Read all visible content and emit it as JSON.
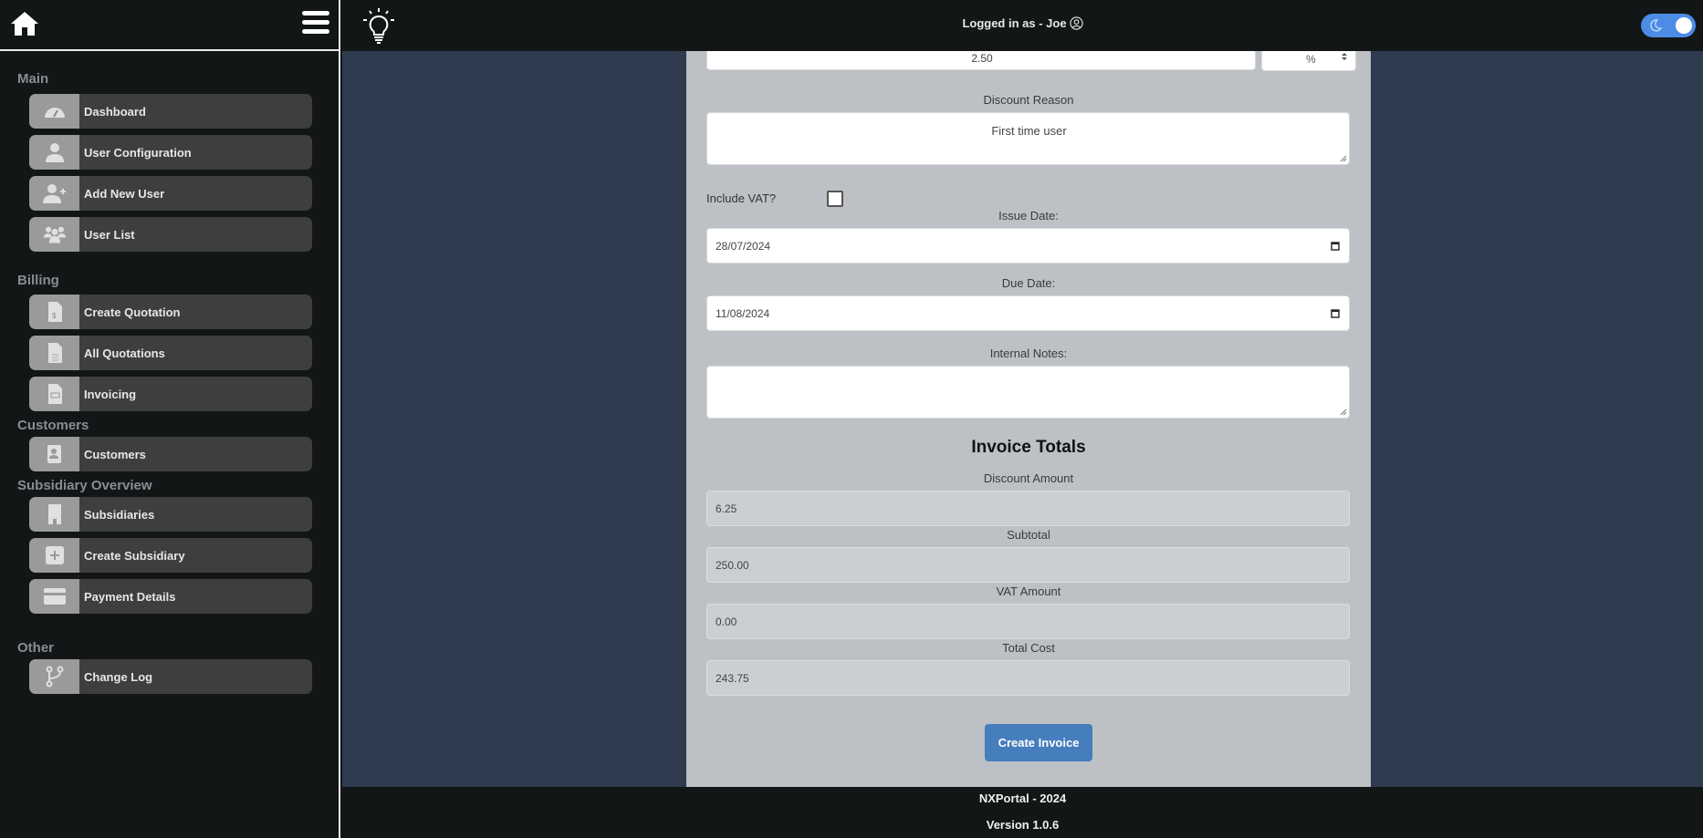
{
  "sidebar": {
    "sections": [
      {
        "title": "Main",
        "items": [
          {
            "label": "Dashboard",
            "icon": "gauge-icon"
          },
          {
            "label": "User Configuration",
            "icon": "user-icon"
          },
          {
            "label": "Add New User",
            "icon": "user-plus-icon"
          },
          {
            "label": "User List",
            "icon": "users-icon"
          }
        ]
      },
      {
        "title": "Billing",
        "items": [
          {
            "label": "Create Quotation",
            "icon": "invoice-dollar-icon"
          },
          {
            "label": "All Quotations",
            "icon": "file-lines-icon"
          },
          {
            "label": "Invoicing",
            "icon": "file-invoice-icon"
          }
        ]
      },
      {
        "title": "Customers",
        "items": [
          {
            "label": "Customers",
            "icon": "address-book-icon"
          }
        ]
      },
      {
        "title": "Subsidiary Overview",
        "items": [
          {
            "label": "Subsidiaries",
            "icon": "building-icon"
          },
          {
            "label": "Create Subsidiary",
            "icon": "plus-square-icon"
          },
          {
            "label": "Payment Details",
            "icon": "credit-card-icon"
          }
        ]
      },
      {
        "title": "Other",
        "items": [
          {
            "label": "Change Log",
            "icon": "code-branch-icon"
          }
        ]
      }
    ]
  },
  "topbar": {
    "logged_in_text": "Logged in as - Joe",
    "theme_toggle": {
      "mode": "dark",
      "on": true
    },
    "accent_color": "#4c8ce6"
  },
  "form": {
    "discount_value": "2.50",
    "discount_type": "%",
    "discount_reason_label": "Discount Reason",
    "discount_reason_value": "First time user",
    "include_vat_label": "Include VAT?",
    "include_vat_checked": false,
    "issue_date_label": "Issue Date:",
    "issue_date_value": "28/07/2024",
    "due_date_label": "Due Date:",
    "due_date_value": "11/08/2024",
    "internal_notes_label": "Internal Notes:",
    "internal_notes_value": ""
  },
  "totals": {
    "heading": "Invoice Totals",
    "discount_amount_label": "Discount Amount",
    "discount_amount_value": "6.25",
    "subtotal_label": "Subtotal",
    "subtotal_value": "250.00",
    "vat_amount_label": "VAT Amount",
    "vat_amount_value": "0.00",
    "total_cost_label": "Total Cost",
    "total_cost_value": "243.75"
  },
  "actions": {
    "create_invoice_label": "Create Invoice",
    "button_color": "#467dbd"
  },
  "footer": {
    "line1": "NXPortal - 2024",
    "line2": "Version 1.0.6"
  }
}
